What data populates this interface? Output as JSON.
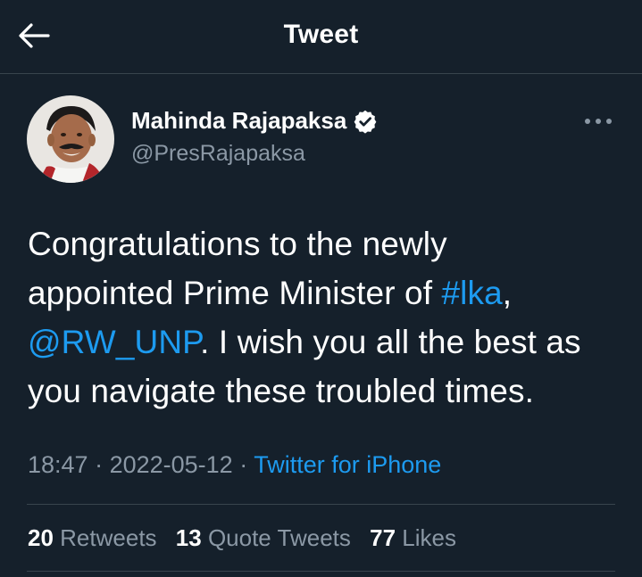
{
  "colors": {
    "background": "#15202b",
    "text_primary": "#ffffff",
    "text_secondary": "#8b98a5",
    "link": "#1d9bf0",
    "divider": "#38444d"
  },
  "header": {
    "back_icon": "arrow-left-icon",
    "title": "Tweet"
  },
  "author": {
    "display_name": "Mahinda Rajapaksa",
    "verified_icon": "verified-badge-icon",
    "handle": "@PresRajapaksa",
    "more_icon": "more-horizontal-icon"
  },
  "tweet": {
    "line1": "Congratulations to the newly",
    "line2_text": "appointed Prime Minister of ",
    "hashtag": "#lka",
    "line2_end": ",",
    "mention": "@RW_UNP",
    "line3_text": ". I wish you all the best as",
    "line4": "you navigate these troubled times."
  },
  "meta": {
    "time": "18:47",
    "sep1": " · ",
    "date": "2022-05-12",
    "sep2": " · ",
    "source": "Twitter for iPhone"
  },
  "stats": {
    "retweets_count": "20",
    "retweets_label": "Retweets",
    "quotes_count": "13",
    "quotes_label": "Quote Tweets",
    "likes_count": "77",
    "likes_label": "Likes"
  }
}
